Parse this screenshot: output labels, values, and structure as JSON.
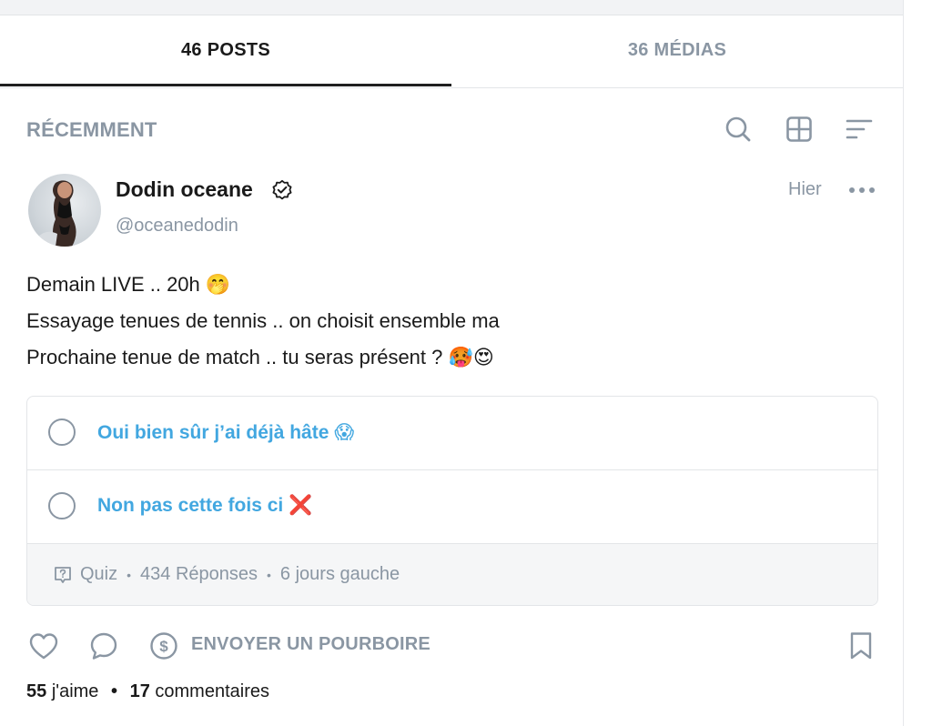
{
  "tabs": [
    {
      "label": "46 POSTS",
      "active": true
    },
    {
      "label": "36 MÉDIAS",
      "active": false
    }
  ],
  "section": {
    "title": "RÉCEMMENT"
  },
  "toolbar_icons": [
    "search-icon",
    "grid-icon",
    "sort-icon"
  ],
  "post": {
    "author_name": "Dodin oceane",
    "handle": "@oceanedodin",
    "date": "Hier",
    "text_lines": [
      "Demain LIVE .. 20h 🤭",
      "Essayage tenues de tennis .. on choisit ensemble ma",
      "Prochaine tenue de match .. tu seras présent ? 🥵😍"
    ]
  },
  "poll": {
    "options": [
      {
        "label": "Oui bien sûr j’ai déjà hâte 😱"
      },
      {
        "label": "Non pas cette fois ci ❌"
      }
    ],
    "type": "Quiz",
    "responses": "434 Réponses",
    "time_left": "6 jours gauche"
  },
  "actions": {
    "tip_label": "ENVOYER UN POURBOIRE"
  },
  "stats": {
    "likes_count": "55",
    "likes_label": "j'aime",
    "comments_count": "17",
    "comments_label": "commentaires"
  },
  "colors": {
    "accent": "#42a7e0",
    "muted": "#8a96a3",
    "text": "#1a1a1a",
    "border": "#e3e5e8"
  }
}
